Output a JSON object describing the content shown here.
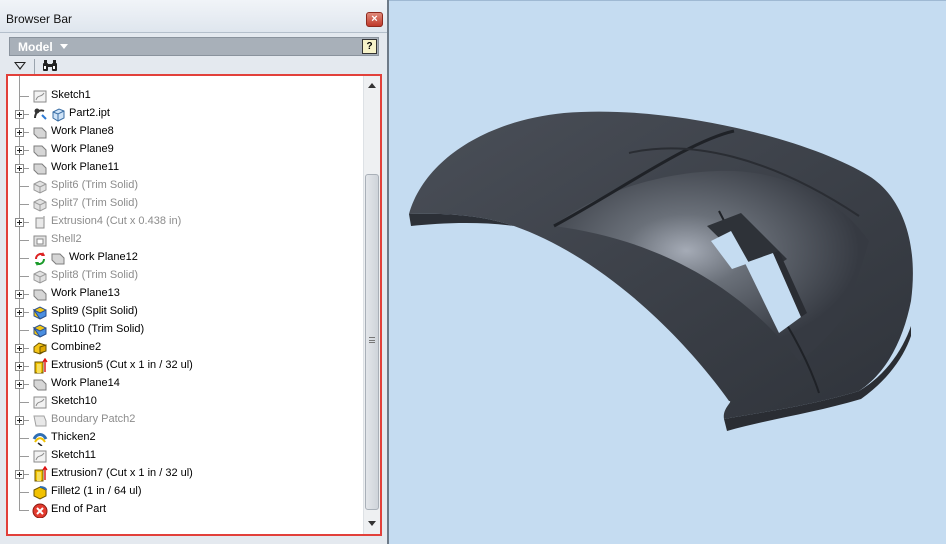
{
  "window": {
    "title": "Browser Bar",
    "close_glyph": "×"
  },
  "model_bar": {
    "label": "Model",
    "help_glyph": "?"
  },
  "toolbar": {
    "filter_icon": "filter-icon",
    "find_icon": "binoculars-icon"
  },
  "tree": {
    "items": [
      {
        "label": "Sketch1",
        "icon": "sketch-icon",
        "expander": false,
        "dimmed": false,
        "extra_icon": null
      },
      {
        "label": "Part2.ipt",
        "icon": "part-icon",
        "expander": true,
        "dimmed": false,
        "extra_icon": "derived-link-icon"
      },
      {
        "label": "Work Plane8",
        "icon": "work-plane-icon",
        "expander": true,
        "dimmed": false,
        "extra_icon": null
      },
      {
        "label": "Work Plane9",
        "icon": "work-plane-icon",
        "expander": true,
        "dimmed": false,
        "extra_icon": null
      },
      {
        "label": "Work Plane11",
        "icon": "work-plane-icon",
        "expander": true,
        "dimmed": false,
        "extra_icon": null
      },
      {
        "label": "Split6 (Trim Solid)",
        "icon": "split-icon",
        "expander": false,
        "dimmed": true,
        "extra_icon": null
      },
      {
        "label": "Split7 (Trim Solid)",
        "icon": "split-icon",
        "expander": false,
        "dimmed": true,
        "extra_icon": null
      },
      {
        "label": "Extrusion4 (Cut x 0.438 in)",
        "icon": "extrusion-icon",
        "expander": true,
        "dimmed": true,
        "extra_icon": null
      },
      {
        "label": "Shell2",
        "icon": "shell-icon",
        "expander": false,
        "dimmed": true,
        "extra_icon": null
      },
      {
        "label": "Work Plane12",
        "icon": "work-plane-icon",
        "expander": false,
        "dimmed": false,
        "extra_icon": "rebuild-icon"
      },
      {
        "label": "Split8 (Trim Solid)",
        "icon": "split-icon",
        "expander": false,
        "dimmed": true,
        "extra_icon": null
      },
      {
        "label": "Work Plane13",
        "icon": "work-plane-icon",
        "expander": true,
        "dimmed": false,
        "extra_icon": null
      },
      {
        "label": "Split9 (Split Solid)",
        "icon": "split-solid-icon",
        "expander": true,
        "dimmed": false,
        "extra_icon": null
      },
      {
        "label": "Split10 (Trim Solid)",
        "icon": "split-solid-icon",
        "expander": false,
        "dimmed": false,
        "extra_icon": null
      },
      {
        "label": "Combine2",
        "icon": "combine-icon",
        "expander": true,
        "dimmed": false,
        "extra_icon": null
      },
      {
        "label": "Extrusion5 (Cut x 1 in / 32 ul)",
        "icon": "extrusion-active-icon",
        "expander": true,
        "dimmed": false,
        "extra_icon": null
      },
      {
        "label": "Work Plane14",
        "icon": "work-plane-icon",
        "expander": true,
        "dimmed": false,
        "extra_icon": null
      },
      {
        "label": "Sketch10",
        "icon": "sketch-icon",
        "expander": false,
        "dimmed": false,
        "extra_icon": null
      },
      {
        "label": "Boundary Patch2",
        "icon": "boundary-patch-icon",
        "expander": true,
        "dimmed": true,
        "extra_icon": null
      },
      {
        "label": "Thicken2",
        "icon": "thicken-icon",
        "expander": false,
        "dimmed": false,
        "extra_icon": null
      },
      {
        "label": "Sketch11",
        "icon": "sketch-icon",
        "expander": false,
        "dimmed": false,
        "extra_icon": null
      },
      {
        "label": "Extrusion7 (Cut x 1 in / 32 ul)",
        "icon": "extrusion-active-icon",
        "expander": true,
        "dimmed": false,
        "extra_icon": null
      },
      {
        "label": "Fillet2 (1 in / 64 ul)",
        "icon": "fillet-icon",
        "expander": false,
        "dimmed": false,
        "extra_icon": null
      },
      {
        "label": "End of Part",
        "icon": "end-of-part-icon",
        "expander": false,
        "dimmed": false,
        "extra_icon": null
      }
    ]
  },
  "scrollbar": {
    "grip_glyph": "≡"
  },
  "viewport": {
    "model": "mouse-shell-model"
  },
  "colors": {
    "viewport_bg": "#c5dcf1",
    "selection_outline": "#e2403a",
    "model_body": "#3a3e46",
    "dimmed_text": "#8c8c8c"
  }
}
